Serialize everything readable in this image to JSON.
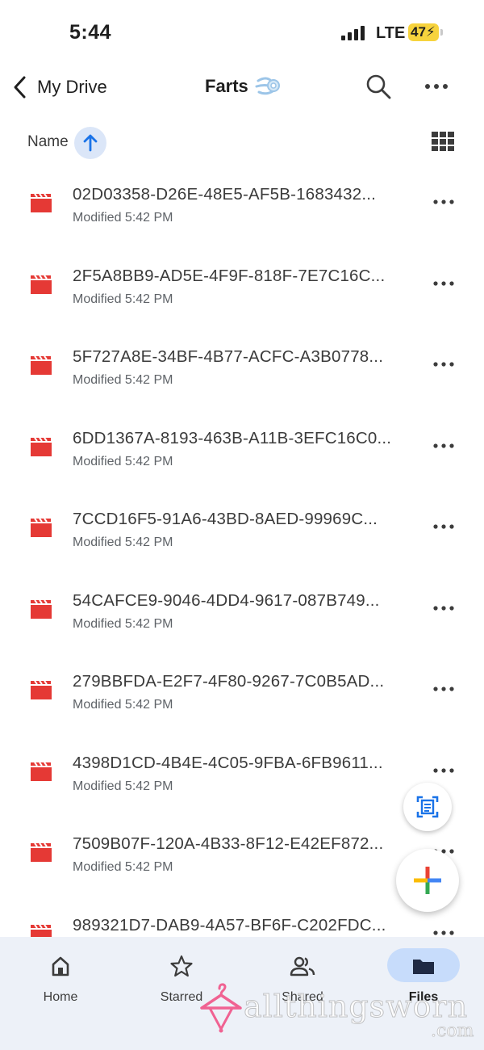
{
  "status_bar": {
    "time": "5:44",
    "network": "LTE",
    "battery": "47",
    "battery_color": "#f7d33d"
  },
  "top_bar": {
    "back_label": "My Drive",
    "folder_title": "Farts",
    "folder_emoji_icon": "dash-symbol-icon"
  },
  "sort": {
    "label": "Name",
    "direction": "ascending"
  },
  "files": [
    {
      "name": "02D03358-D26E-48E5-AF5B-1683432...",
      "meta": "Modified 5:42 PM"
    },
    {
      "name": "2F5A8BB9-AD5E-4F9F-818F-7E7C16C...",
      "meta": "Modified 5:42 PM"
    },
    {
      "name": "5F727A8E-34BF-4B77-ACFC-A3B0778...",
      "meta": "Modified 5:42 PM"
    },
    {
      "name": "6DD1367A-8193-463B-A11B-3EFC16C0...",
      "meta": "Modified 5:42 PM"
    },
    {
      "name": "7CCD16F5-91A6-43BD-8AED-99969C...",
      "meta": "Modified 5:42 PM"
    },
    {
      "name": "54CAFCE9-9046-4DD4-9617-087B749...",
      "meta": "Modified 5:42 PM"
    },
    {
      "name": "279BBFDA-E2F7-4F80-9267-7C0B5AD...",
      "meta": "Modified 5:42 PM"
    },
    {
      "name": "4398D1CD-4B4E-4C05-9FBA-6FB9611...",
      "meta": "Modified 5:42 PM"
    },
    {
      "name": "7509B07F-120A-4B33-8F12-E42EF872...",
      "meta": "Modified 5:42 PM"
    },
    {
      "name": "989321D7-DAB9-4A57-BF6F-C202FDC...",
      "meta": ""
    }
  ],
  "file_icon": "video-file-icon",
  "file_icon_color": "#e53935",
  "bottom_nav": [
    {
      "label": "Home",
      "icon": "home-icon"
    },
    {
      "label": "Starred",
      "icon": "star-icon"
    },
    {
      "label": "Shared",
      "icon": "shared-people-icon"
    },
    {
      "label": "Files",
      "icon": "folder-icon",
      "active": true
    }
  ],
  "watermark": {
    "text": "allthingsworn",
    "suffix": ".com"
  },
  "colors": {
    "accent": "#1a73e8",
    "nav_background": "#edf1f8",
    "active_pill": "#c7dcfb"
  }
}
